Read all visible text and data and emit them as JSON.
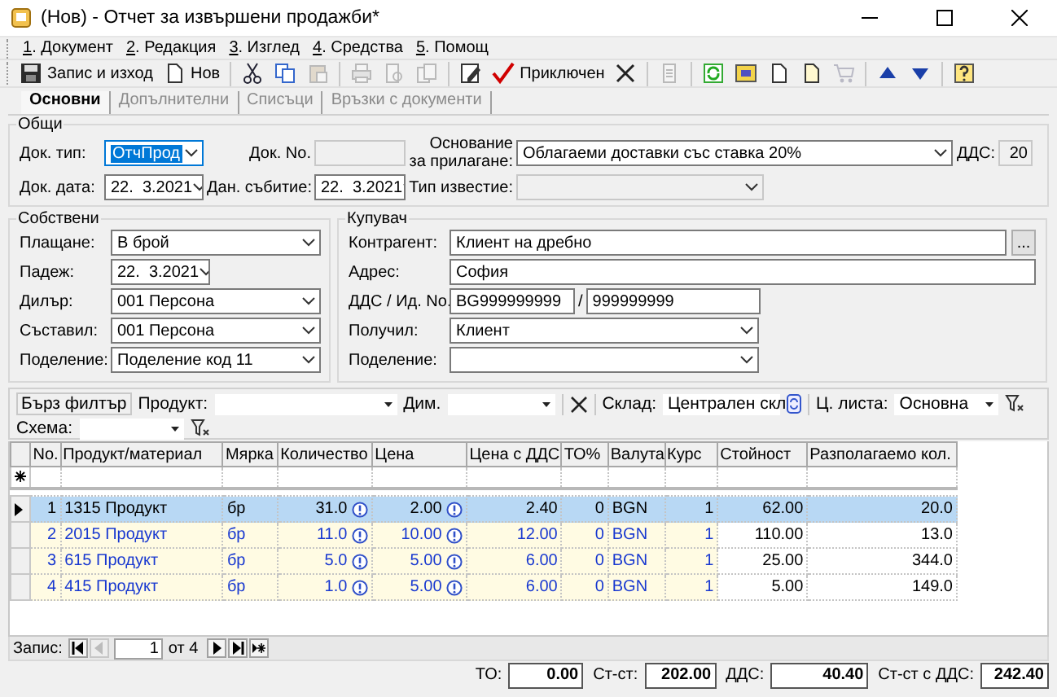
{
  "window": {
    "title": "(Нов) - Отчет за извършени продажби*"
  },
  "menu": [
    {
      "label": "1. Документ"
    },
    {
      "label": "2. Редакция"
    },
    {
      "label": "3. Изглед"
    },
    {
      "label": "4. Средства"
    },
    {
      "label": "5. Помощ"
    }
  ],
  "toolbar": [
    {
      "kind": "button",
      "label": "Запис и изход",
      "disabled": false
    },
    {
      "kind": "button",
      "label": "Нов",
      "disabled": false
    },
    {
      "kind": "separator"
    },
    {
      "kind": "icon",
      "disabled": false
    },
    {
      "kind": "icon",
      "disabled": false
    },
    {
      "kind": "icon",
      "disabled": true
    },
    {
      "kind": "separator"
    },
    {
      "kind": "icon",
      "disabled": true
    },
    {
      "kind": "icon",
      "disabled": true
    },
    {
      "kind": "icon",
      "disabled": true
    },
    {
      "kind": "separator"
    },
    {
      "kind": "icon",
      "disabled": false
    },
    {
      "kind": "button",
      "label": "Приключен",
      "disabled": false
    },
    {
      "kind": "icon",
      "disabled": false
    },
    {
      "kind": "separator"
    },
    {
      "kind": "icon",
      "disabled": true
    },
    {
      "kind": "separator"
    },
    {
      "kind": "icon",
      "disabled": false
    },
    {
      "kind": "icon",
      "disabled": false
    },
    {
      "kind": "icon",
      "disabled": false
    },
    {
      "kind": "icon",
      "disabled": false
    },
    {
      "kind": "icon",
      "disabled": true
    },
    {
      "kind": "separator"
    },
    {
      "kind": "icon",
      "disabled": false
    },
    {
      "kind": "icon",
      "disabled": false
    },
    {
      "kind": "separator"
    },
    {
      "kind": "icon",
      "disabled": false
    }
  ],
  "tabs": [
    {
      "label": "Основни",
      "selected": true
    },
    {
      "label": "Допълнителни",
      "selected": false
    },
    {
      "label": "Списъци",
      "selected": false
    },
    {
      "label": "Връзки с документи",
      "selected": false
    }
  ],
  "general": {
    "title": "Общи",
    "fields": [
      {
        "label": "Док. тип:",
        "kind": "combo",
        "value": "ОтчПрод",
        "focused": true,
        "disabled": false
      },
      {
        "label": "Док. No.",
        "kind": "text",
        "focused": false,
        "disabled": true
      },
      {
        "label": "Основание за прилагане:",
        "kind": "combo",
        "value": "Облагаеми доставки със ставка 20%",
        "focused": false,
        "disabled": false
      },
      {
        "label": "ДДС:",
        "kind": "text",
        "value": "20",
        "focused": false,
        "disabled": true
      },
      {
        "label": "Док. дата:",
        "kind": "date",
        "value": "22.  3.2021",
        "focused": false,
        "disabled": false
      },
      {
        "label": "Дан. събитие:",
        "kind": "date",
        "value": "22.  3.2021",
        "focused": false,
        "disabled": false
      },
      {
        "label": "Тип известие:",
        "kind": "combo",
        "focused": false,
        "disabled": true
      }
    ]
  },
  "owner": {
    "title": "Собствени",
    "fields": [
      {
        "label": "Плащане:",
        "kind": "combo",
        "value": "В брой"
      },
      {
        "label": "Падеж:",
        "kind": "date",
        "value": "22.  3.2021"
      },
      {
        "label": "Дилър:",
        "kind": "combo",
        "value": "001 Персона"
      },
      {
        "label": "Съставил:",
        "kind": "combo",
        "value": "001 Персона"
      },
      {
        "label": "Поделение:",
        "kind": "combo",
        "value": "Поделение код 11"
      }
    ]
  },
  "buyer": {
    "title": "Купувач",
    "fields": [
      {
        "label": "Контрагент:",
        "kind": "lookup",
        "value": "Клиент на дребно",
        "button": "..."
      },
      {
        "label": "Адрес:",
        "kind": "text",
        "value": "София"
      },
      {
        "label": "ДДС / Ид. No.",
        "kind": "pair",
        "value": "BG999999999",
        "separator": "/",
        "value2": "999999999"
      },
      {
        "label": "Получил:",
        "kind": "combo",
        "value": "Клиент"
      },
      {
        "label": "Поделение:",
        "kind": "combo"
      }
    ]
  },
  "filter": {
    "button": "Бърз филтър",
    "row1": [
      {
        "kind": "combo",
        "label": "Продукт:"
      },
      {
        "kind": "combo",
        "label": "Дим."
      },
      {
        "kind": "clear"
      },
      {
        "kind": "combo",
        "label": "Склад:",
        "value": "Централен скл"
      },
      {
        "kind": "refresh"
      },
      {
        "kind": "combo",
        "label": "Ц. листа:",
        "value": "Основна"
      },
      {
        "kind": "funnel"
      }
    ],
    "row2": [
      {
        "kind": "combo",
        "label": "Схема:"
      },
      {
        "kind": "funnel"
      }
    ]
  },
  "grid": {
    "columns": [
      {
        "label": "No.",
        "kind": "index"
      },
      {
        "label": "Продукт/материал",
        "kind": "text"
      },
      {
        "label": "Мярка",
        "kind": "text"
      },
      {
        "label": "Количество",
        "kind": "alert"
      },
      {
        "label": "Цена",
        "kind": "alert"
      },
      {
        "label": "Цена с ДДС",
        "kind": "number"
      },
      {
        "label": "ТО%",
        "kind": "number"
      },
      {
        "label": "Валута",
        "kind": "text"
      },
      {
        "label": "Курс",
        "kind": "number"
      },
      {
        "label": "Стойност",
        "kind": "calculated"
      },
      {
        "label": "Разполагаемо кол.",
        "kind": "calculated"
      }
    ],
    "rows": [
      {
        "selected": true,
        "cells": [
          "1",
          "1315 Продукт",
          "бр",
          "31.0",
          "2.00",
          "2.40",
          "0",
          "BGN",
          "1",
          "62.00",
          "20.0"
        ]
      },
      {
        "selected": false,
        "cells": [
          "2",
          "2015 Продукт",
          "бр",
          "11.0",
          "10.00",
          "12.00",
          "0",
          "BGN",
          "1",
          "110.00",
          "13.0"
        ]
      },
      {
        "selected": false,
        "cells": [
          "3",
          "615 Продукт",
          "бр",
          "5.0",
          "5.00",
          "6.00",
          "0",
          "BGN",
          "1",
          "25.00",
          "344.0"
        ]
      },
      {
        "selected": false,
        "cells": [
          "4",
          "415 Продукт",
          "бр",
          "1.0",
          "5.00",
          "6.00",
          "0",
          "BGN",
          "1",
          "5.00",
          "149.0"
        ]
      }
    ]
  },
  "navigator": {
    "label": "Запис:",
    "current": "1",
    "total": "от 4"
  },
  "totals": [
    {
      "label": "ТО:",
      "value": "0.00"
    },
    {
      "label": "Ст-ст:",
      "value": "202.00"
    },
    {
      "label": "ДДС:",
      "value": "40.40"
    },
    {
      "label": "Ст-ст с ДДС:",
      "value": "242.40"
    }
  ]
}
